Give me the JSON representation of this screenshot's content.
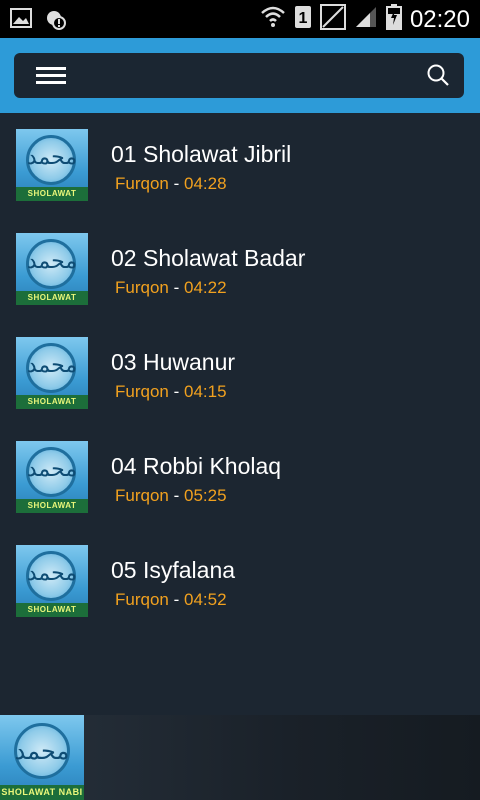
{
  "status_bar": {
    "time": "02:20",
    "sim_label": "1",
    "icons": [
      "image-icon",
      "settings-alert-icon",
      "wifi-icon",
      "sim-1-icon",
      "no-signal-icon",
      "signal-icon",
      "battery-charging-icon"
    ]
  },
  "header": {
    "menu_icon": "hamburger-menu-icon",
    "search_icon": "search-icon"
  },
  "thumb": {
    "calligraphy": "محمد",
    "band_text": "SHOLAWAT NABI"
  },
  "tracks": [
    {
      "title": "01 Sholawat Jibril",
      "artist": "Furqon",
      "separator": "-",
      "duration": "04:28"
    },
    {
      "title": "02 Sholawat Badar",
      "artist": "Furqon",
      "separator": "-",
      "duration": "04:22"
    },
    {
      "title": "03 Huwanur",
      "artist": "Furqon",
      "separator": "-",
      "duration": "04:15"
    },
    {
      "title": "04 Robbi Kholaq",
      "artist": "Furqon",
      "separator": "-",
      "duration": "05:25"
    },
    {
      "title": "05 Isyfalana",
      "artist": "Furqon",
      "separator": "-",
      "duration": "04:52"
    }
  ],
  "colors": {
    "app_bar": "#2d9bd8",
    "background": "#1c2631",
    "accent": "#f1a11f"
  }
}
